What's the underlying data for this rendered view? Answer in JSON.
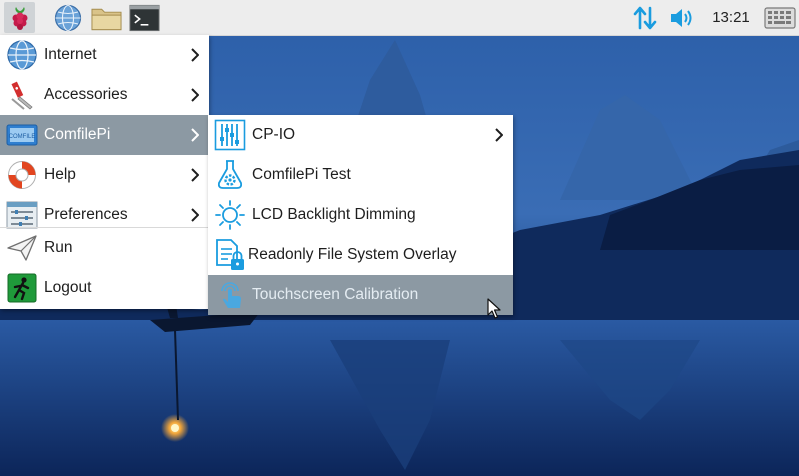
{
  "taskbar": {
    "clock": "13:21",
    "icons": [
      "raspberry-icon",
      "web-browser-icon",
      "file-manager-icon",
      "terminal-icon",
      "network-icon",
      "volume-icon",
      "keyboard-icon"
    ]
  },
  "main_menu": {
    "items": [
      {
        "label": "Internet",
        "icon": "globe-icon",
        "has_submenu": true
      },
      {
        "label": "Accessories",
        "icon": "accessories-icon",
        "has_submenu": true
      },
      {
        "label": "ComfilePi",
        "icon": "comfilepi-icon",
        "has_submenu": true,
        "highlighted": true
      },
      {
        "label": "Help",
        "icon": "help-lifebuoy-icon",
        "has_submenu": true
      },
      {
        "label": "Preferences",
        "icon": "preferences-icon",
        "has_submenu": true
      },
      {
        "label": "Run",
        "icon": "paper-plane-icon",
        "has_submenu": false
      },
      {
        "label": "Logout",
        "icon": "exit-icon",
        "has_submenu": false
      }
    ]
  },
  "submenu": {
    "items": [
      {
        "label": "CP-IO",
        "icon": "sliders-icon",
        "has_submenu": true
      },
      {
        "label": "ComfilePi Test",
        "icon": "flask-gear-icon",
        "has_submenu": false
      },
      {
        "label": "LCD Backlight Dimming",
        "icon": "sun-icon",
        "has_submenu": false
      },
      {
        "label": "Readonly File System Overlay",
        "icon": "locked-document-icon",
        "has_submenu": false
      },
      {
        "label": "Touchscreen Calibration",
        "icon": "touch-hand-icon",
        "has_submenu": false,
        "highlighted": true
      }
    ]
  },
  "colors": {
    "taskbar_bg": "#ededed",
    "menu_bg": "#ffffff",
    "highlight_bg": "#8c99a3",
    "accent_blue": "#1a9cdf",
    "wallpaper_sky": "#1f4e8c",
    "wallpaper_dark": "#0b1f45"
  }
}
